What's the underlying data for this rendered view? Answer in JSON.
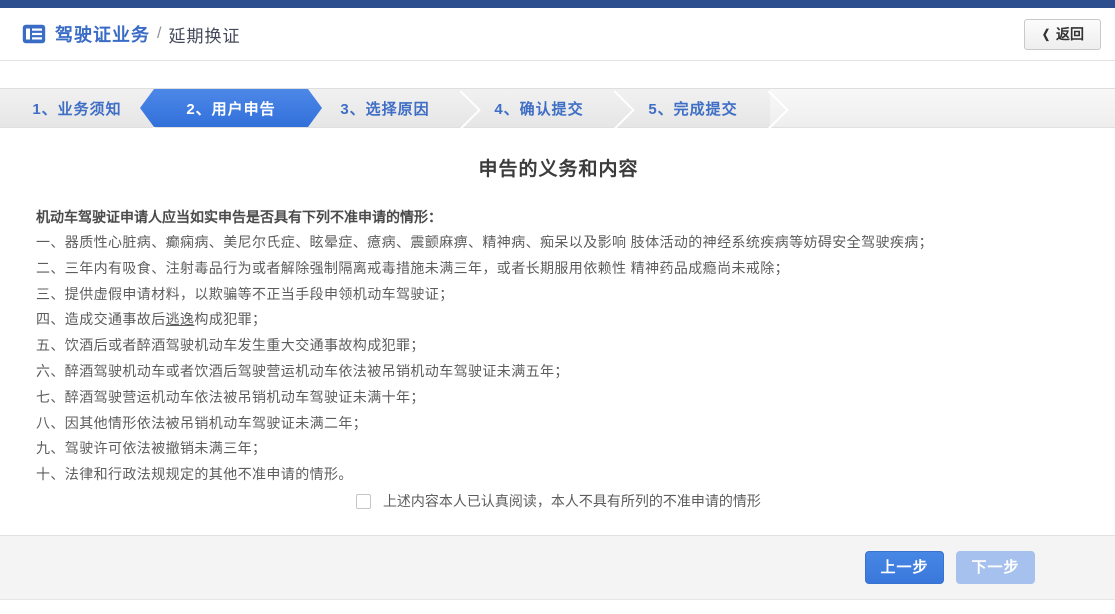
{
  "header": {
    "section_title": "驾驶证业务",
    "separator": "/",
    "page_title": "延期换证",
    "back_button_label": "返回",
    "back_chevron": "❮"
  },
  "steps": [
    {
      "label": "1、业务须知",
      "active": false
    },
    {
      "label": "2、用户申告",
      "active": true
    },
    {
      "label": "3、选择原因",
      "active": false
    },
    {
      "label": "4、确认提交",
      "active": false
    },
    {
      "label": "5、完成提交",
      "active": false
    }
  ],
  "declaration": {
    "heading": "申告的义务和内容",
    "intro": "机动车驾驶证申请人应当如实申告是否具有下列不准申请的情形：",
    "items": [
      "一、器质性心脏病、癫痫病、美尼尔氏症、眩晕症、癔病、震颤麻痹、精神病、痴呆以及影响 肢体活动的神经系统疾病等妨碍安全驾驶疾病；",
      "二、三年内有吸食、注射毒品行为或者解除强制隔离戒毒措施未满三年，或者长期服用依赖性 精神药品成瘾尚未戒除；",
      "三、提供虚假申请材料，以欺骗等不正当手段申领机动车驾驶证；",
      {
        "prefix": "四、造成交通事故后",
        "underlined": "逃逸",
        "suffix": "构成犯罪；"
      },
      "五、饮酒后或者醉酒驾驶机动车发生重大交通事故构成犯罪；",
      "六、醉酒驾驶机动车或者饮酒后驾驶营运机动车依法被吊销机动车驾驶证未满五年；",
      "七、醉酒驾驶营运机动车依法被吊销机动车驾驶证未满十年；",
      "八、因其他情形依法被吊销机动车驾驶证未满二年；",
      "九、驾驶许可依法被撤销未满三年；",
      "十、法律和行政法规规定的其他不准申请的情形。"
    ],
    "checkbox_label": "上述内容本人已认真阅读，本人不具有所列的不准申请的情形",
    "checkbox_checked": false
  },
  "footer": {
    "prev_label": "上一步",
    "next_label": "下一步",
    "next_disabled": true
  },
  "colors": {
    "topbar_navy": "#2c4d8e",
    "link_blue": "#3a6cc6",
    "active_step_blue": "#3b77e0",
    "button_blue": "#3d7de2",
    "button_disabled_blue": "#a7c1ee"
  }
}
